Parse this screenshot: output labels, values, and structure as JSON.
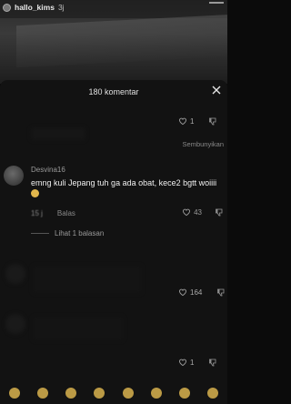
{
  "video": {
    "username": "hallo_kims",
    "time": "3j"
  },
  "sheet": {
    "title": "180 komentar",
    "hide_replies_label": "Sembunyikan"
  },
  "pinned_reply": {
    "likes": "1"
  },
  "comment": {
    "username": "Desvina16",
    "text": "emng kuli Jepang tuh ga ada obat, kece2 bgtt woiiii",
    "time": "15 j",
    "reply_label": "Balas",
    "likes": "43",
    "view_replies_label": "Lihat 1 balasan"
  },
  "comment2": {
    "likes": "164"
  },
  "comment3": {
    "likes": "1"
  },
  "icons": {
    "close": "close-icon",
    "heart": "heart-icon",
    "dislike": "dislike-icon"
  }
}
